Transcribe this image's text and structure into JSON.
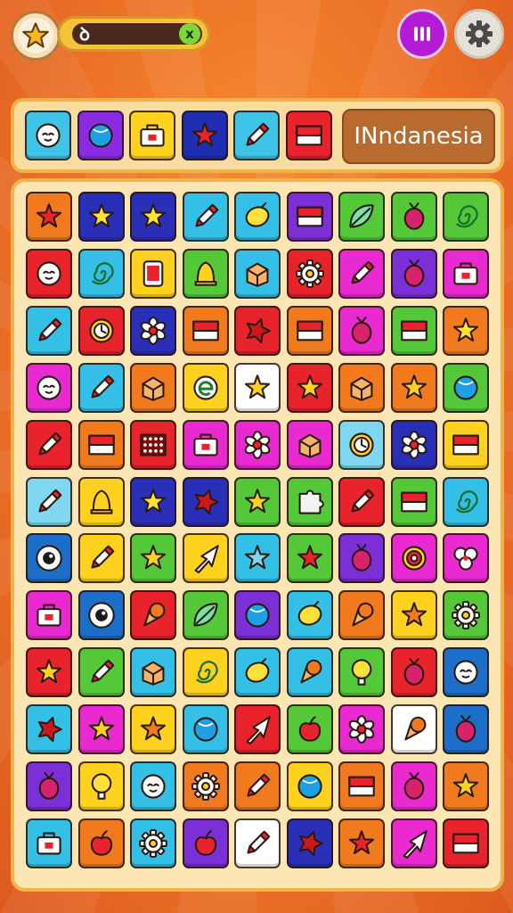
{
  "header": {
    "progress_label": "ꝺ",
    "close_symbol": "x"
  },
  "target_bar": {
    "country_label": "INndanesia",
    "items": [
      {
        "bg": "#3fc4e8",
        "icon": "face-icon"
      },
      {
        "bg": "#8a2be2",
        "icon": "ball-icon"
      },
      {
        "bg": "#ffd21f",
        "icon": "bag-icon"
      },
      {
        "bg": "#1d2fb0",
        "icon": "star-icon",
        "fg": "#e8232b"
      },
      {
        "bg": "#3fc4e8",
        "icon": "pen-icon"
      },
      {
        "bg": "#e8232b",
        "icon": "flag-icon"
      }
    ]
  },
  "board": {
    "rows": [
      [
        {
          "bg": "#f07a1d",
          "icon": "star-icon",
          "fg": "#e8232b"
        },
        {
          "bg": "#2a2fb8",
          "icon": "star-icon",
          "fg": "#ffe13a"
        },
        {
          "bg": "#2a2fb8",
          "icon": "star-icon",
          "fg": "#ffe13a"
        },
        {
          "bg": "#33bfe6",
          "icon": "pen-icon"
        },
        {
          "bg": "#33bfe6",
          "icon": "lemon-icon"
        },
        {
          "bg": "#7b2fd6",
          "icon": "flag-icon"
        },
        {
          "bg": "#55c83a",
          "icon": "leaf-icon"
        },
        {
          "bg": "#55c83a",
          "icon": "radish-icon"
        },
        {
          "bg": "#55c83a",
          "icon": "spiral-icon"
        }
      ],
      [
        {
          "bg": "#e8232b",
          "icon": "face-icon"
        },
        {
          "bg": "#33bfe6",
          "icon": "spiral-icon"
        },
        {
          "bg": "#ffd21f",
          "icon": "phone-icon"
        },
        {
          "bg": "#55c83a",
          "icon": "bell-icon"
        },
        {
          "bg": "#33bfe6",
          "icon": "box-icon"
        },
        {
          "bg": "#e8232b",
          "icon": "gear-icon"
        },
        {
          "bg": "#e82ad0",
          "icon": "pen-icon"
        },
        {
          "bg": "#7b2fd6",
          "icon": "radish-icon"
        },
        {
          "bg": "#e82ad0",
          "icon": "bag-icon"
        }
      ],
      [
        {
          "bg": "#33bfe6",
          "icon": "pen-icon"
        },
        {
          "bg": "#e8232b",
          "icon": "clock-icon"
        },
        {
          "bg": "#2a2fb8",
          "icon": "flower-icon"
        },
        {
          "bg": "#f07a1d",
          "icon": "flag-icon"
        },
        {
          "bg": "#e8232b",
          "icon": "splat-icon"
        },
        {
          "bg": "#f07a1d",
          "icon": "flag-icon"
        },
        {
          "bg": "#e82ad0",
          "icon": "radish-icon"
        },
        {
          "bg": "#55c83a",
          "icon": "flag-icon"
        },
        {
          "bg": "#f07a1d",
          "icon": "star-icon",
          "fg": "#ffe13a"
        }
      ],
      [
        {
          "bg": "#e82ad0",
          "icon": "face-icon"
        },
        {
          "bg": "#33bfe6",
          "icon": "pen-icon"
        },
        {
          "bg": "#f07a1d",
          "icon": "box-icon"
        },
        {
          "bg": "#ffd21f",
          "icon": "e-icon"
        },
        {
          "bg": "#ffffff",
          "icon": "star-icon",
          "fg": "#ffd21f"
        },
        {
          "bg": "#e8232b",
          "icon": "star-icon",
          "fg": "#ffd21f"
        },
        {
          "bg": "#f07a1d",
          "icon": "box-icon"
        },
        {
          "bg": "#f07a1d",
          "icon": "star-icon",
          "fg": "#ffd21f"
        },
        {
          "bg": "#55c83a",
          "icon": "ball-icon"
        }
      ],
      [
        {
          "bg": "#e8232b",
          "icon": "pen-icon"
        },
        {
          "bg": "#f07a1d",
          "icon": "flag-icon"
        },
        {
          "bg": "#e8232b",
          "icon": "grid-icon"
        },
        {
          "bg": "#e82ad0",
          "icon": "bag-icon"
        },
        {
          "bg": "#e82ad0",
          "icon": "flower-icon"
        },
        {
          "bg": "#e82ad0",
          "icon": "box-icon"
        },
        {
          "bg": "#7fd8f0",
          "icon": "clock-icon"
        },
        {
          "bg": "#2a2fb8",
          "icon": "flower-icon"
        },
        {
          "bg": "#ffd21f",
          "icon": "flag-icon"
        }
      ],
      [
        {
          "bg": "#7fd8f0",
          "icon": "pen-icon"
        },
        {
          "bg": "#ffd21f",
          "icon": "bell-icon"
        },
        {
          "bg": "#2a2fb8",
          "icon": "star-icon",
          "fg": "#ffe13a"
        },
        {
          "bg": "#2a2fb8",
          "icon": "splat-icon"
        },
        {
          "bg": "#55c83a",
          "icon": "star-icon",
          "fg": "#ffd21f"
        },
        {
          "bg": "#55c83a",
          "icon": "puzzle-icon"
        },
        {
          "bg": "#e8232b",
          "icon": "pen-icon"
        },
        {
          "bg": "#55c83a",
          "icon": "flag-icon"
        },
        {
          "bg": "#33bfe6",
          "icon": "spiral-icon"
        }
      ],
      [
        {
          "bg": "#1d6ec8",
          "icon": "eye-icon"
        },
        {
          "bg": "#ffd21f",
          "icon": "pen-icon"
        },
        {
          "bg": "#55c83a",
          "icon": "star-icon",
          "fg": "#ffd21f"
        },
        {
          "bg": "#ffd21f",
          "icon": "arrow-icon"
        },
        {
          "bg": "#33bfe6",
          "icon": "star-icon",
          "fg": "#7fd8f0"
        },
        {
          "bg": "#55c83a",
          "icon": "star-icon",
          "fg": "#e8232b"
        },
        {
          "bg": "#7b2fd6",
          "icon": "radish-icon"
        },
        {
          "bg": "#e82ad0",
          "icon": "ring-icon"
        },
        {
          "bg": "#e82ad0",
          "icon": "clover-icon"
        }
      ],
      [
        {
          "bg": "#e82ad0",
          "icon": "bag-icon"
        },
        {
          "bg": "#1d6ec8",
          "icon": "eye-icon"
        },
        {
          "bg": "#e8232b",
          "icon": "cone-icon"
        },
        {
          "bg": "#55c83a",
          "icon": "leaf-icon"
        },
        {
          "bg": "#7b2fd6",
          "icon": "ball-icon"
        },
        {
          "bg": "#33bfe6",
          "icon": "lemon-icon"
        },
        {
          "bg": "#f07a1d",
          "icon": "cone-icon"
        },
        {
          "bg": "#ffd21f",
          "icon": "star-icon",
          "fg": "#f07a1d"
        },
        {
          "bg": "#55c83a",
          "icon": "gear-icon"
        }
      ],
      [
        {
          "bg": "#e8232b",
          "icon": "star-icon",
          "fg": "#ffd21f"
        },
        {
          "bg": "#55c83a",
          "icon": "pen-icon"
        },
        {
          "bg": "#33bfe6",
          "icon": "box-icon"
        },
        {
          "bg": "#ffd21f",
          "icon": "spiral-icon"
        },
        {
          "bg": "#33bfe6",
          "icon": "lemon-icon"
        },
        {
          "bg": "#33bfe6",
          "icon": "cone-icon"
        },
        {
          "bg": "#55c83a",
          "icon": "bulb-icon"
        },
        {
          "bg": "#e8232b",
          "icon": "radish-icon"
        },
        {
          "bg": "#1d6ec8",
          "icon": "face-icon"
        }
      ],
      [
        {
          "bg": "#33bfe6",
          "icon": "splat-icon"
        },
        {
          "bg": "#e82ad0",
          "icon": "star-icon",
          "fg": "#ffd21f"
        },
        {
          "bg": "#ffd21f",
          "icon": "star-icon",
          "fg": "#f07a1d"
        },
        {
          "bg": "#33bfe6",
          "icon": "ball-icon"
        },
        {
          "bg": "#e8232b",
          "icon": "arrow-icon"
        },
        {
          "bg": "#55c83a",
          "icon": "apple-icon"
        },
        {
          "bg": "#e82ad0",
          "icon": "flower-icon"
        },
        {
          "bg": "#ffffff",
          "icon": "cone-icon"
        },
        {
          "bg": "#1d6ec8",
          "icon": "radish-icon"
        }
      ],
      [
        {
          "bg": "#7b2fd6",
          "icon": "radish-icon"
        },
        {
          "bg": "#ffd21f",
          "icon": "bulb-icon"
        },
        {
          "bg": "#33bfe6",
          "icon": "face-icon"
        },
        {
          "bg": "#f07a1d",
          "icon": "gear-icon"
        },
        {
          "bg": "#f07a1d",
          "icon": "pen-icon"
        },
        {
          "bg": "#ffd21f",
          "icon": "ball-icon"
        },
        {
          "bg": "#f07a1d",
          "icon": "flag-icon"
        },
        {
          "bg": "#e82ad0",
          "icon": "radish-icon"
        },
        {
          "bg": "#f07a1d",
          "icon": "star-icon",
          "fg": "#ffd21f"
        }
      ],
      [
        {
          "bg": "#33bfe6",
          "icon": "bag-icon"
        },
        {
          "bg": "#f07a1d",
          "icon": "apple-icon"
        },
        {
          "bg": "#33bfe6",
          "icon": "gear-icon"
        },
        {
          "bg": "#7b2fd6",
          "icon": "apple-icon"
        },
        {
          "bg": "#ffffff",
          "icon": "pen-icon"
        },
        {
          "bg": "#2a2fb8",
          "icon": "splat-icon"
        },
        {
          "bg": "#f07a1d",
          "icon": "star-icon",
          "fg": "#e8232b"
        },
        {
          "bg": "#e82ad0",
          "icon": "arrow-icon"
        },
        {
          "bg": "#e8232b",
          "icon": "flag-icon"
        }
      ]
    ]
  }
}
